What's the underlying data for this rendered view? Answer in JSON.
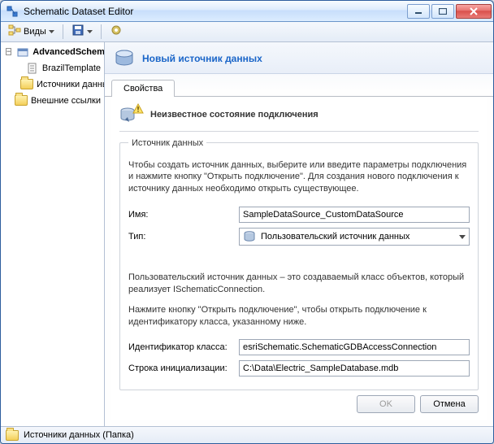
{
  "titlebar": {
    "title": "Schematic Dataset Editor"
  },
  "toolbar": {
    "views_label": "Виды"
  },
  "sidebar": {
    "items": [
      {
        "label": "AdvancedSchematic",
        "bold": true,
        "expand": "-",
        "icon": "dataset"
      },
      {
        "label": "BrazilTemplate",
        "depth": 1,
        "icon": "template"
      },
      {
        "label": "Источники данных",
        "depth": 1,
        "icon": "folder"
      },
      {
        "label": "Внешние ссылки",
        "expand": "",
        "icon": "folder"
      }
    ]
  },
  "header": {
    "title": "Новый источник данных"
  },
  "tabs": {
    "properties": "Свойства"
  },
  "status": {
    "text": "Неизвестное состояние подключения"
  },
  "group": {
    "legend": "Источник данных",
    "intro": "Чтобы создать источник данных, выберите или введите параметры подключения и нажмите кнопку \"Открыть подключение\". Для создания нового подключения к источнику данных необходимо открыть существующее.",
    "name_label": "Имя:",
    "name_value": "SampleDataSource_CustomDataSource",
    "type_label": "Тип:",
    "type_value": "Пользовательский источник данных",
    "custom_intro": "Пользовательский источник данных – это создаваемый класс объектов, который реализует ISchematicConnection.",
    "open_hint": "Нажмите кнопку \"Открыть подключение\", чтобы открыть подключение к идентификатору класса, указанному ниже.",
    "classid_label": "Идентификатор класса:",
    "classid_value": "esriSchematic.SchematicGDBAccessConnection",
    "init_label": "Строка инициализации:",
    "init_value": "C:\\Data\\Electric_SampleDatabase.mdb"
  },
  "buttons": {
    "ok": "OK",
    "cancel": "Отмена"
  },
  "statusbar": {
    "text": "Источники данных (Папка)"
  }
}
